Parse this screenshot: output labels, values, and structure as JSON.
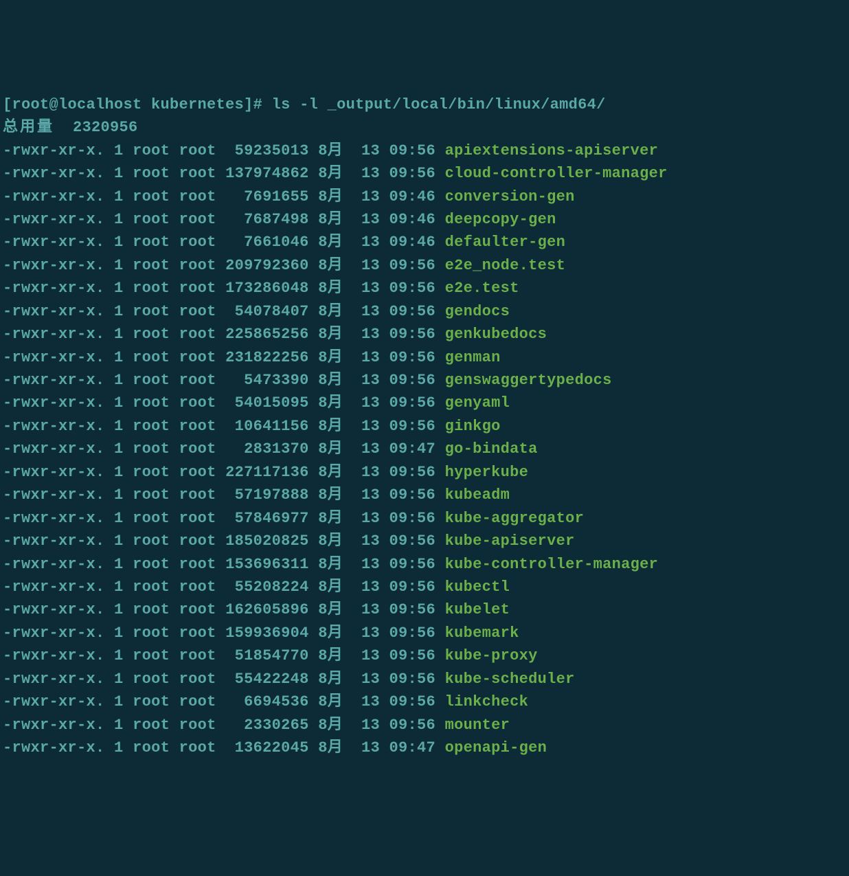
{
  "prompt": {
    "user_host": "[root@localhost kubernetes]#",
    "command": "ls -l _output/local/bin/linux/amd64/"
  },
  "summary": {
    "label": "总用量",
    "total": "2320956"
  },
  "files": [
    {
      "perms": "-rwxr-xr-x.",
      "links": "1",
      "owner": "root",
      "group": "root",
      "size": " 59235013",
      "month": "8月",
      "day": "13",
      "time": "09:56",
      "name": "apiextensions-apiserver"
    },
    {
      "perms": "-rwxr-xr-x.",
      "links": "1",
      "owner": "root",
      "group": "root",
      "size": "137974862",
      "month": "8月",
      "day": "13",
      "time": "09:56",
      "name": "cloud-controller-manager"
    },
    {
      "perms": "-rwxr-xr-x.",
      "links": "1",
      "owner": "root",
      "group": "root",
      "size": "  7691655",
      "month": "8月",
      "day": "13",
      "time": "09:46",
      "name": "conversion-gen"
    },
    {
      "perms": "-rwxr-xr-x.",
      "links": "1",
      "owner": "root",
      "group": "root",
      "size": "  7687498",
      "month": "8月",
      "day": "13",
      "time": "09:46",
      "name": "deepcopy-gen"
    },
    {
      "perms": "-rwxr-xr-x.",
      "links": "1",
      "owner": "root",
      "group": "root",
      "size": "  7661046",
      "month": "8月",
      "day": "13",
      "time": "09:46",
      "name": "defaulter-gen"
    },
    {
      "perms": "-rwxr-xr-x.",
      "links": "1",
      "owner": "root",
      "group": "root",
      "size": "209792360",
      "month": "8月",
      "day": "13",
      "time": "09:56",
      "name": "e2e_node.test"
    },
    {
      "perms": "-rwxr-xr-x.",
      "links": "1",
      "owner": "root",
      "group": "root",
      "size": "173286048",
      "month": "8月",
      "day": "13",
      "time": "09:56",
      "name": "e2e.test"
    },
    {
      "perms": "-rwxr-xr-x.",
      "links": "1",
      "owner": "root",
      "group": "root",
      "size": " 54078407",
      "month": "8月",
      "day": "13",
      "time": "09:56",
      "name": "gendocs"
    },
    {
      "perms": "-rwxr-xr-x.",
      "links": "1",
      "owner": "root",
      "group": "root",
      "size": "225865256",
      "month": "8月",
      "day": "13",
      "time": "09:56",
      "name": "genkubedocs"
    },
    {
      "perms": "-rwxr-xr-x.",
      "links": "1",
      "owner": "root",
      "group": "root",
      "size": "231822256",
      "month": "8月",
      "day": "13",
      "time": "09:56",
      "name": "genman"
    },
    {
      "perms": "-rwxr-xr-x.",
      "links": "1",
      "owner": "root",
      "group": "root",
      "size": "  5473390",
      "month": "8月",
      "day": "13",
      "time": "09:56",
      "name": "genswaggertypedocs"
    },
    {
      "perms": "-rwxr-xr-x.",
      "links": "1",
      "owner": "root",
      "group": "root",
      "size": " 54015095",
      "month": "8月",
      "day": "13",
      "time": "09:56",
      "name": "genyaml"
    },
    {
      "perms": "-rwxr-xr-x.",
      "links": "1",
      "owner": "root",
      "group": "root",
      "size": " 10641156",
      "month": "8月",
      "day": "13",
      "time": "09:56",
      "name": "ginkgo"
    },
    {
      "perms": "-rwxr-xr-x.",
      "links": "1",
      "owner": "root",
      "group": "root",
      "size": "  2831370",
      "month": "8月",
      "day": "13",
      "time": "09:47",
      "name": "go-bindata"
    },
    {
      "perms": "-rwxr-xr-x.",
      "links": "1",
      "owner": "root",
      "group": "root",
      "size": "227117136",
      "month": "8月",
      "day": "13",
      "time": "09:56",
      "name": "hyperkube"
    },
    {
      "perms": "-rwxr-xr-x.",
      "links": "1",
      "owner": "root",
      "group": "root",
      "size": " 57197888",
      "month": "8月",
      "day": "13",
      "time": "09:56",
      "name": "kubeadm"
    },
    {
      "perms": "-rwxr-xr-x.",
      "links": "1",
      "owner": "root",
      "group": "root",
      "size": " 57846977",
      "month": "8月",
      "day": "13",
      "time": "09:56",
      "name": "kube-aggregator"
    },
    {
      "perms": "-rwxr-xr-x.",
      "links": "1",
      "owner": "root",
      "group": "root",
      "size": "185020825",
      "month": "8月",
      "day": "13",
      "time": "09:56",
      "name": "kube-apiserver"
    },
    {
      "perms": "-rwxr-xr-x.",
      "links": "1",
      "owner": "root",
      "group": "root",
      "size": "153696311",
      "month": "8月",
      "day": "13",
      "time": "09:56",
      "name": "kube-controller-manager"
    },
    {
      "perms": "-rwxr-xr-x.",
      "links": "1",
      "owner": "root",
      "group": "root",
      "size": " 55208224",
      "month": "8月",
      "day": "13",
      "time": "09:56",
      "name": "kubectl"
    },
    {
      "perms": "-rwxr-xr-x.",
      "links": "1",
      "owner": "root",
      "group": "root",
      "size": "162605896",
      "month": "8月",
      "day": "13",
      "time": "09:56",
      "name": "kubelet"
    },
    {
      "perms": "-rwxr-xr-x.",
      "links": "1",
      "owner": "root",
      "group": "root",
      "size": "159936904",
      "month": "8月",
      "day": "13",
      "time": "09:56",
      "name": "kubemark"
    },
    {
      "perms": "-rwxr-xr-x.",
      "links": "1",
      "owner": "root",
      "group": "root",
      "size": " 51854770",
      "month": "8月",
      "day": "13",
      "time": "09:56",
      "name": "kube-proxy"
    },
    {
      "perms": "-rwxr-xr-x.",
      "links": "1",
      "owner": "root",
      "group": "root",
      "size": " 55422248",
      "month": "8月",
      "day": "13",
      "time": "09:56",
      "name": "kube-scheduler"
    },
    {
      "perms": "-rwxr-xr-x.",
      "links": "1",
      "owner": "root",
      "group": "root",
      "size": "  6694536",
      "month": "8月",
      "day": "13",
      "time": "09:56",
      "name": "linkcheck"
    },
    {
      "perms": "-rwxr-xr-x.",
      "links": "1",
      "owner": "root",
      "group": "root",
      "size": "  2330265",
      "month": "8月",
      "day": "13",
      "time": "09:56",
      "name": "mounter"
    },
    {
      "perms": "-rwxr-xr-x.",
      "links": "1",
      "owner": "root",
      "group": "root",
      "size": " 13622045",
      "month": "8月",
      "day": "13",
      "time": "09:47",
      "name": "openapi-gen"
    }
  ]
}
